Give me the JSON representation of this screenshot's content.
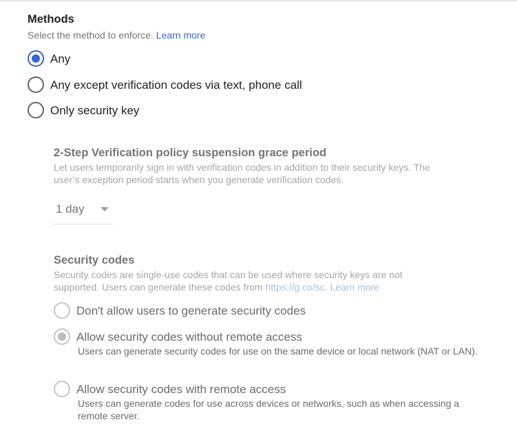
{
  "methods": {
    "title": "Methods",
    "subtitle": "Select the method to enforce.",
    "learn_more": "Learn more",
    "options": [
      {
        "label": "Any",
        "selected": true
      },
      {
        "label": "Any except verification codes via text, phone call",
        "selected": false
      },
      {
        "label": "Only security key",
        "selected": false
      }
    ]
  },
  "grace": {
    "title": "2-Step Verification policy suspension grace period",
    "desc1": "Let users temporarily sign in with verification codes in addition to their security keys. The",
    "desc2": "user’s exception period starts when you generate verification codes.",
    "value": "1 day"
  },
  "codes": {
    "title": "Security codes",
    "desc1": "Security codes are single-use codes that can be used where security keys are not",
    "desc2_prefix": "supported. Users can generate these codes from",
    "link": "https://g.co/sc.",
    "learn_more": "Learn more",
    "options": [
      {
        "label": "Don't allow users to generate security codes",
        "desc": "",
        "selected": false
      },
      {
        "label": "Allow security codes without remote access",
        "desc": "Users can generate security codes for use on the same device or local network (NAT or LAN).",
        "selected": true
      },
      {
        "label": "Allow security codes with remote access",
        "desc": "Users can generate codes for use across devices or networks, such as when accessing a remote server.",
        "selected": false
      }
    ]
  },
  "colors": {
    "accent": "#3367d6"
  }
}
